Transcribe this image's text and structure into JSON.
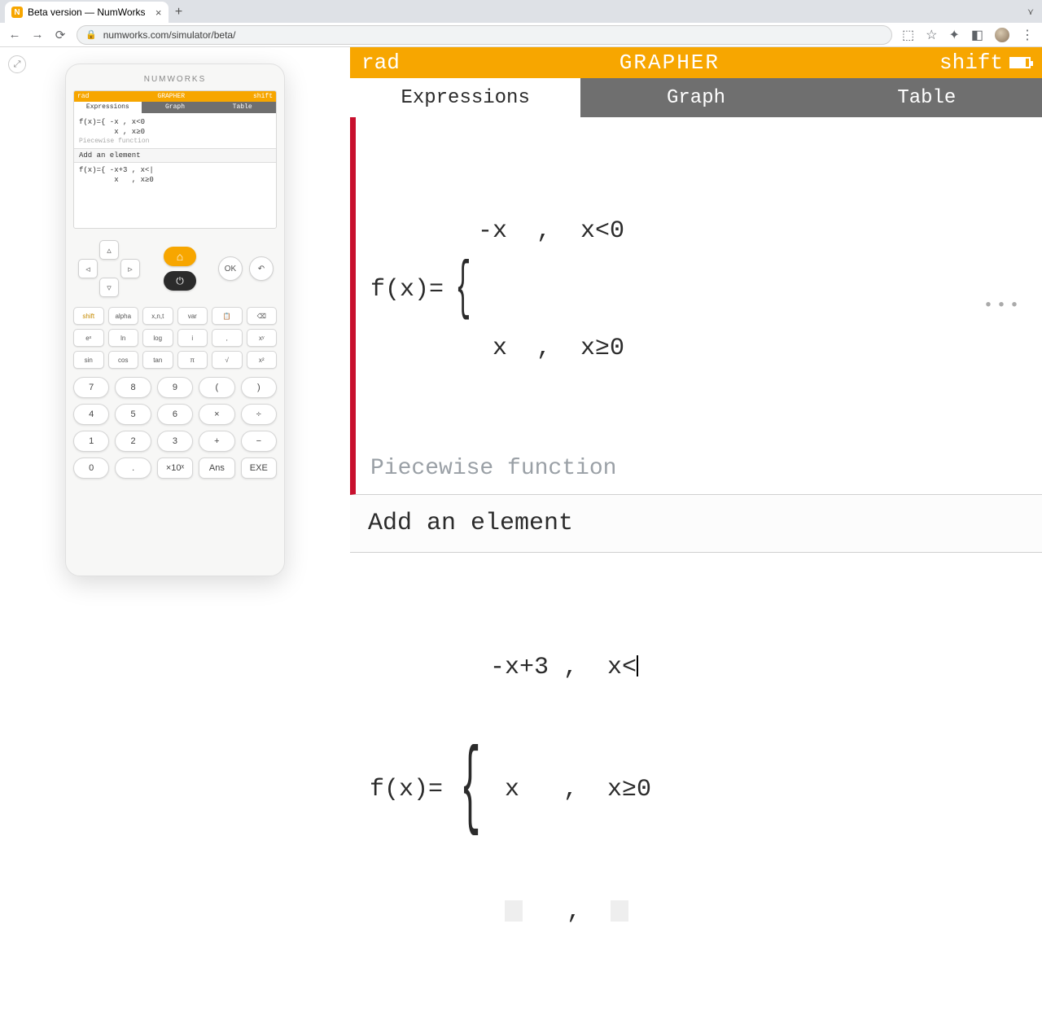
{
  "browser": {
    "tab_title": "Beta version — NumWorks",
    "url": "numworks.com/simulator/beta/"
  },
  "calc_brand": "NUMWORKS",
  "status": {
    "mode": "rad",
    "app": "GRAPHER",
    "indicator": "shift"
  },
  "tabs": {
    "expressions": "Expressions",
    "graph": "Graph",
    "table": "Table"
  },
  "f1": {
    "lhs": "f(x)=",
    "line1": "-x  ,  x<0",
    "line2": " x  ,  x≥0",
    "subtitle": "Piecewise function"
  },
  "add_element": "Add an element",
  "f2": {
    "lhs": "f(x)=",
    "line1": "-x+3 ,  x<",
    "line2": " x   ,  x≥0"
  },
  "mini": {
    "f1a": "f(x)={ -x , x<0",
    "f1b": "        x , x≥0",
    "sub": "Piecewise function",
    "add": "Add an element",
    "f2a": "f(x)={ -x+3 , x<|",
    "f2b": "        x   , x≥0"
  },
  "dpad": {
    "ok": "OK",
    "back": "↶"
  },
  "row1": [
    "shift",
    "alpha",
    "x,n,t",
    "var",
    "📋",
    "⌫"
  ],
  "row2": [
    "eˣ",
    "ln",
    "log",
    "i",
    ",",
    "xʸ"
  ],
  "row3": [
    "sin",
    "cos",
    "tan",
    "π",
    "√",
    "x²"
  ],
  "nums": [
    [
      "7",
      "8",
      "9",
      "(",
      ")"
    ],
    [
      "4",
      "5",
      "6",
      "×",
      "÷"
    ],
    [
      "1",
      "2",
      "3",
      "+",
      "−"
    ],
    [
      "0",
      ".",
      "×10ˣ",
      "Ans",
      "EXE"
    ]
  ]
}
